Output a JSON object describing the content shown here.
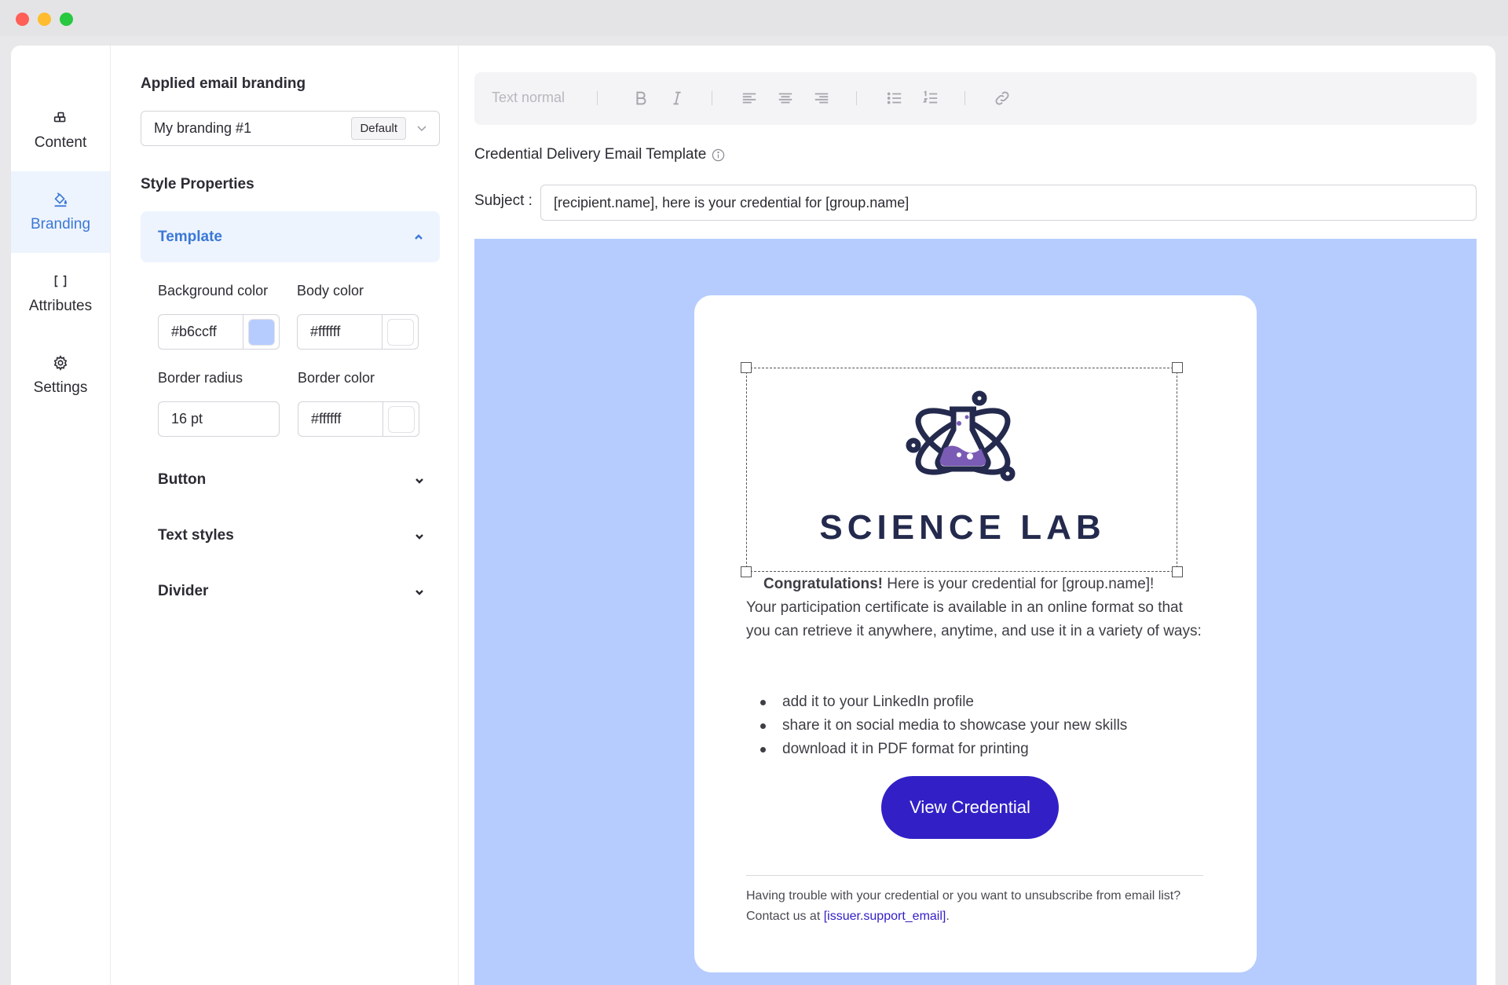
{
  "nav": {
    "items": [
      {
        "label": "Content",
        "icon": "blocks-icon"
      },
      {
        "label": "Branding",
        "icon": "paint-bucket-icon"
      },
      {
        "label": "Attributes",
        "icon": "brackets-icon"
      },
      {
        "label": "Settings",
        "icon": "gear-icon"
      }
    ],
    "active": "Branding"
  },
  "panel": {
    "applied_branding_label": "Applied email branding",
    "branding_value": "My branding #1",
    "branding_badge": "Default",
    "style_properties_label": "Style Properties",
    "template_section": "Template",
    "background_color_label": "Background color",
    "background_color_value": "#b6ccff",
    "body_color_label": "Body color",
    "body_color_value": "#ffffff",
    "border_radius_label": "Border radius",
    "border_radius_value": "16 pt",
    "border_color_label": "Border color",
    "border_color_value": "#ffffff",
    "sections": [
      "Button",
      "Text styles",
      "Divider"
    ]
  },
  "toolbar": {
    "text_style": "Text normal"
  },
  "editor": {
    "template_title": "Credential Delivery Email Template",
    "subject_label": "Subject :",
    "subject_value": "[recipient.name], here is your credential for [group.name]"
  },
  "email": {
    "logo_text": "SCIENCE LAB",
    "congrats_bold": "Congratulations!",
    "congrats_rest": " Here is your credential for [group.name]!",
    "paragraph": "Your participation certificate is available in an online format so that you can retrieve it anywhere, anytime, and use it in a variety of ways:",
    "bullets": [
      "add it to your LinkedIn profile",
      "share it on social media to showcase your new skills",
      "download it in PDF format for printing"
    ],
    "cta_label": "View Credential",
    "footer_text": "Having trouble with your credential or you want to unsubscribe from email list? Contact us at ",
    "footer_link": "[issuer.support_email]",
    "footer_end": "."
  },
  "colors": {
    "accent": "#3a78d6",
    "canvas_bg": "#b6ccff",
    "cta_bg": "#3220c6",
    "logo_navy": "#242a4d",
    "logo_purple": "#7a5bb5"
  }
}
